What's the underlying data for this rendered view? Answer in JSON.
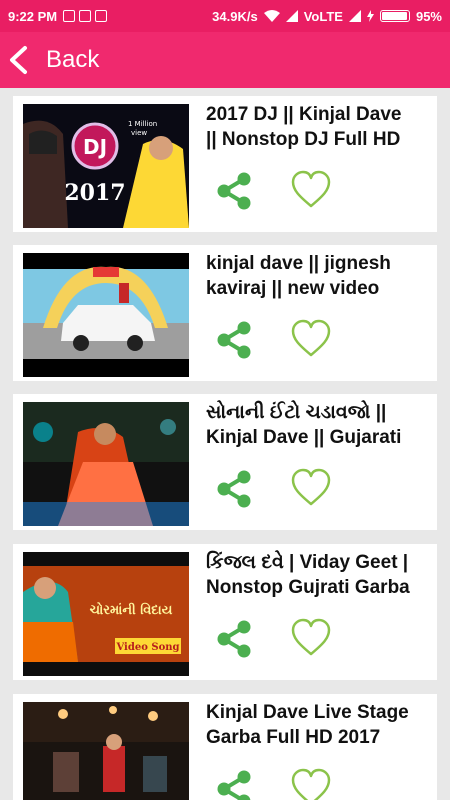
{
  "status_bar": {
    "time": "9:22 PM",
    "speed": "34.9K/s",
    "network": "VoLTE",
    "battery": "95%",
    "battery_level": 0.95
  },
  "app_bar": {
    "back_label": "Back"
  },
  "videos": [
    {
      "title": "2017 DJ || Kinjal Dave || Nonstop DJ Full HD",
      "line1": "2017 DJ || Kinjal Dave",
      "line2": "|| Nonstop DJ Full HD",
      "thumb_text": [
        "DJ",
        "2017",
        "1 Million",
        "view"
      ]
    },
    {
      "title": "kinjal dave || jignesh kaviraj || new video",
      "line1": "kinjal dave || jignesh",
      "line2": "kaviraj || new video",
      "thumb_text": []
    },
    {
      "title": "સોનાની ઈંટો ચડાવજો || Kinjal Dave || Gujarati",
      "line1": "સોનાની ઈંટો ચડાવજો ||",
      "line2": "Kinjal Dave || Gujarati",
      "thumb_text": []
    },
    {
      "title": "કિંજલ દવે | Viday Geet | Nonstop Gujrati Garba",
      "line1": "કિંજલ દવે | Viday Geet |",
      "line2": "Nonstop Gujrati Garba",
      "thumb_text": [
        "ચોરમાંની વિદાય",
        "Video Song"
      ]
    },
    {
      "title": "Kinjal Dave Live Stage Garba Full HD 2017",
      "line1": "Kinjal Dave Live Stage",
      "line2": "Garba Full HD 2017",
      "thumb_text": []
    }
  ],
  "colors": {
    "status_bar": "#e91e63",
    "app_bar": "#f0296e",
    "share_icon": "#4caf50",
    "heart_icon": "#8bc34a"
  }
}
